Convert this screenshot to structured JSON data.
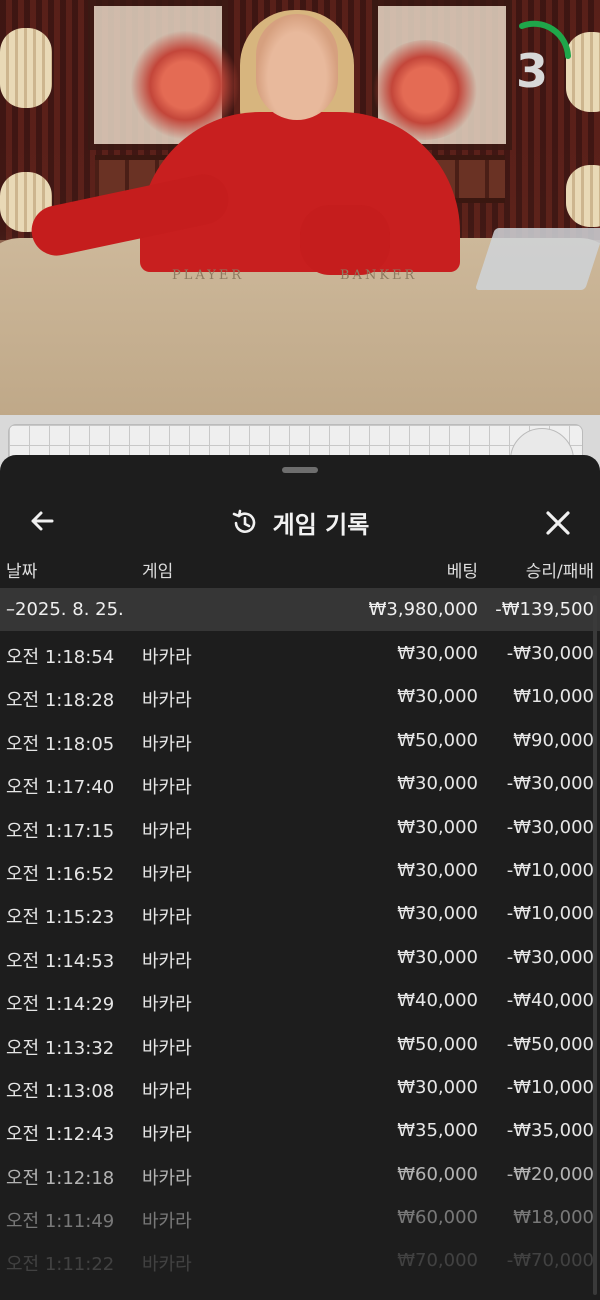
{
  "stream": {
    "table_labels": {
      "player": "PLAYER",
      "banker": "BANKER"
    },
    "countdown": "3",
    "countdown_color": "#1fa64a"
  },
  "sheet": {
    "title": "게임 기록",
    "icons": {
      "back": "arrow-left-icon",
      "history": "history-icon",
      "close": "close-icon"
    },
    "columns": {
      "date": "날짜",
      "game": "게임",
      "bet": "베팅",
      "result": "승리/패배"
    },
    "summary": {
      "date": "–2025. 8. 25.",
      "bet": "₩3,980,000",
      "result": "-₩139,500"
    },
    "rows": [
      {
        "time": "오전 1:18:54",
        "game": "바카라",
        "bet": "₩30,000",
        "result": "-₩30,000"
      },
      {
        "time": "오전 1:18:28",
        "game": "바카라",
        "bet": "₩30,000",
        "result": "₩10,000"
      },
      {
        "time": "오전 1:18:05",
        "game": "바카라",
        "bet": "₩50,000",
        "result": "₩90,000"
      },
      {
        "time": "오전 1:17:40",
        "game": "바카라",
        "bet": "₩30,000",
        "result": "-₩30,000"
      },
      {
        "time": "오전 1:17:15",
        "game": "바카라",
        "bet": "₩30,000",
        "result": "-₩30,000"
      },
      {
        "time": "오전 1:16:52",
        "game": "바카라",
        "bet": "₩30,000",
        "result": "-₩10,000"
      },
      {
        "time": "오전 1:15:23",
        "game": "바카라",
        "bet": "₩30,000",
        "result": "-₩10,000"
      },
      {
        "time": "오전 1:14:53",
        "game": "바카라",
        "bet": "₩30,000",
        "result": "-₩30,000"
      },
      {
        "time": "오전 1:14:29",
        "game": "바카라",
        "bet": "₩40,000",
        "result": "-₩40,000"
      },
      {
        "time": "오전 1:13:32",
        "game": "바카라",
        "bet": "₩50,000",
        "result": "-₩50,000"
      },
      {
        "time": "오전 1:13:08",
        "game": "바카라",
        "bet": "₩30,000",
        "result": "-₩10,000"
      },
      {
        "time": "오전 1:12:43",
        "game": "바카라",
        "bet": "₩35,000",
        "result": "-₩35,000"
      },
      {
        "time": "오전 1:12:18",
        "game": "바카라",
        "bet": "₩60,000",
        "result": "-₩20,000"
      },
      {
        "time": "오전 1:11:49",
        "game": "바카라",
        "bet": "₩60,000",
        "result": "₩18,000"
      },
      {
        "time": "오전 1:11:22",
        "game": "바카라",
        "bet": "₩70,000",
        "result": "-₩70,000"
      }
    ]
  }
}
